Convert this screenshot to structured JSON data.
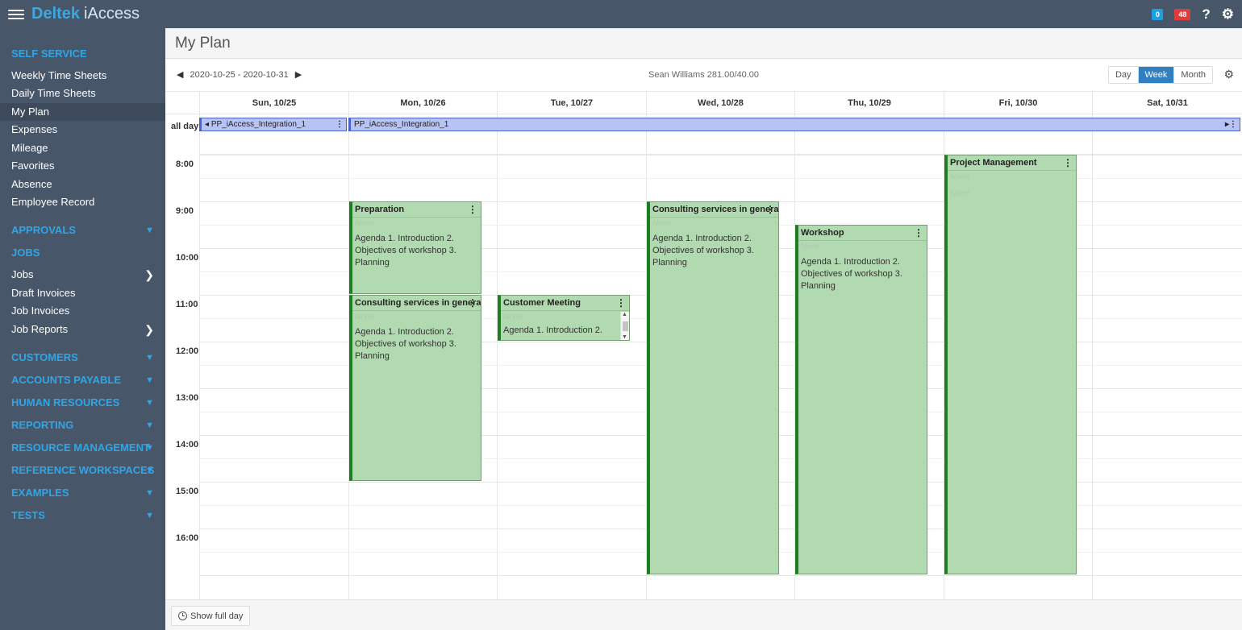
{
  "topbar": {
    "brand_bold": "Deltek",
    "brand_light": "iAccess",
    "notif_count": "0",
    "alert_count": "48",
    "help_glyph": "?",
    "settings_glyph": "⚙"
  },
  "sidebar": {
    "self_service": "SELF SERVICE",
    "self_items": [
      "Weekly Time Sheets",
      "Daily Time Sheets",
      "My Plan",
      "Expenses",
      "Mileage",
      "Favorites",
      "Absence",
      "Employee Record"
    ],
    "approvals": "APPROVALS",
    "jobs_section": "JOBS",
    "jobs_items": [
      "Jobs",
      "Draft Invoices",
      "Job Invoices",
      "Job Reports"
    ],
    "sections": [
      "CUSTOMERS",
      "ACCOUNTS PAYABLE",
      "HUMAN RESOURCES",
      "REPORTING",
      "RESOURCE MANAGEMENT",
      "REFERENCE WORKSPACES",
      "EXAMPLES",
      "TESTS"
    ]
  },
  "main": {
    "title": "My Plan",
    "date_range": "2020-10-25 - 2020-10-31",
    "user_summary": "Sean Williams 281.00/40.00",
    "views": [
      "Day",
      "Week",
      "Month"
    ],
    "active_view": "Week",
    "allday_label": "all day",
    "days": [
      "Sun, 10/25",
      "Mon, 10/26",
      "Tue, 10/27",
      "Wed, 10/28",
      "Thu, 10/29",
      "Fri, 10/30",
      "Sat, 10/31"
    ],
    "hours": [
      "8:00",
      "9:00",
      "10:00",
      "11:00",
      "12:00",
      "13:00",
      "14:00",
      "15:00",
      "16:00"
    ],
    "show_full_day": "Show full day"
  },
  "allday_events": [
    {
      "title": "PP_iAccess_Integration_1",
      "prefix": "◂"
    },
    {
      "title": "PP_iAccess_Integration_1",
      "suffix": "▸"
    }
  ],
  "events": [
    {
      "title": "Preparation",
      "sub": "None",
      "desc": "Agenda 1. Introduction 2. Objectives of workshop 3. Planning"
    },
    {
      "title": "Consulting services in general",
      "sub": "None",
      "desc": "Agenda 1. Introduction 2. Objectives of workshop 3. Planning"
    },
    {
      "title": "Customer Meeting",
      "sub": "None",
      "desc": "Agenda 1. Introduction 2."
    },
    {
      "title": "Consulting services in general",
      "sub": "None",
      "desc": "Agenda 1. Introduction 2. Objectives of workshop 3. Planning"
    },
    {
      "title": "Workshop",
      "sub": "None",
      "desc": "Agenda 1. Introduction 2. Objectives of workshop 3. Planning"
    },
    {
      "title": "Project Management",
      "sub": "None",
      "sub2": "None",
      "desc": ""
    }
  ],
  "colors": {
    "topbar": "#48566a",
    "accent_blue": "#2fa6e6",
    "event_green": "#b2dab0",
    "event_border": "#1e7d1e",
    "allday_blue": "#b8c3f5"
  }
}
